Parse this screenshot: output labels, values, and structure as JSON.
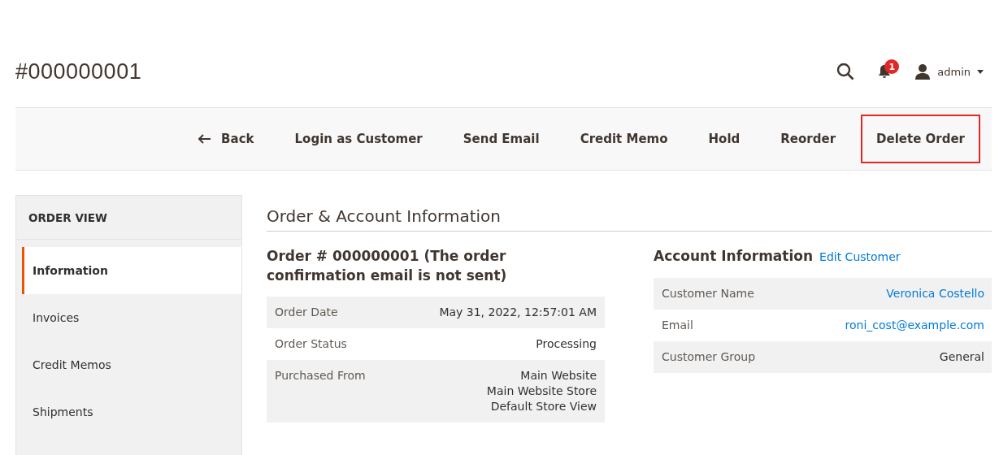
{
  "header": {
    "title": "#000000001",
    "notifications": "1",
    "user": "admin"
  },
  "toolbar": {
    "buttons": [
      {
        "label": "Back",
        "kind": "back",
        "highlighted": false
      },
      {
        "label": "Login as Customer",
        "kind": "plain",
        "highlighted": false
      },
      {
        "label": "Send Email",
        "kind": "plain",
        "highlighted": false
      },
      {
        "label": "Credit Memo",
        "kind": "plain",
        "highlighted": false
      },
      {
        "label": "Hold",
        "kind": "plain",
        "highlighted": false
      },
      {
        "label": "Reorder",
        "kind": "plain",
        "highlighted": false
      },
      {
        "label": "Delete Order",
        "kind": "plain",
        "highlighted": true
      }
    ]
  },
  "sidebar": {
    "title": "ORDER VIEW",
    "items": [
      {
        "label": "Information",
        "selected": true
      },
      {
        "label": "Invoices",
        "selected": false
      },
      {
        "label": "Credit Memos",
        "selected": false
      },
      {
        "label": "Shipments",
        "selected": false
      }
    ]
  },
  "section_title": "Order & Account Information",
  "order": {
    "title": "Order # 000000001 (The order confirmation email is not sent)",
    "rows": [
      {
        "label": "Order Date",
        "value": [
          "May 31, 2022, 12:57:01 AM"
        ],
        "link": false
      },
      {
        "label": "Order Status",
        "value": [
          "Processing"
        ],
        "link": false
      },
      {
        "label": "Purchased From",
        "value": [
          "Main Website",
          "Main Website Store",
          "Default Store View"
        ],
        "link": false
      }
    ]
  },
  "account": {
    "title": "Account Information",
    "edit_link": "Edit Customer",
    "rows": [
      {
        "label": "Customer Name",
        "value": [
          "Veronica Costello"
        ],
        "link": true
      },
      {
        "label": "Email",
        "value": [
          "roni_cost@example.com"
        ],
        "link": true
      },
      {
        "label": "Customer Group",
        "value": [
          "General"
        ],
        "link": false
      }
    ]
  }
}
